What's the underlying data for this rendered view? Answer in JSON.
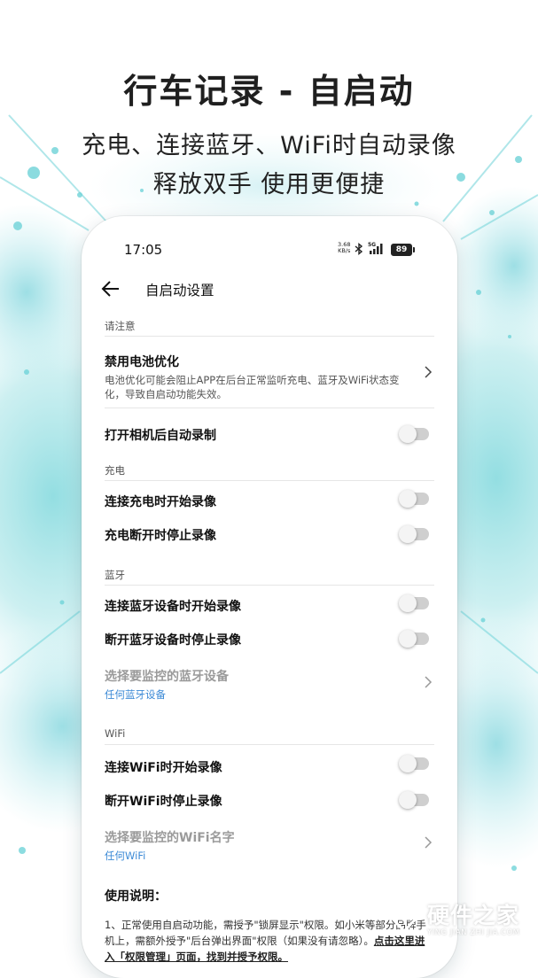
{
  "header": {
    "title": "行车记录 - 自启动",
    "subtitle_line1": "充电、连接蓝牙、WiFi时自动录像",
    "subtitle_line2": "释放双手  使用更便捷"
  },
  "status_bar": {
    "time": "17:05",
    "net_speed_value": "3.68",
    "net_speed_unit": "KB/s",
    "network": "5G",
    "battery": "89"
  },
  "page": {
    "title": "自启动设置"
  },
  "sections": {
    "notice": "请注意",
    "charging": "充电",
    "bluetooth": "蓝牙",
    "wifi": "WiFi"
  },
  "settings": {
    "battery_opt": {
      "title": "禁用电池优化",
      "desc": "电池优化可能会阻止APP在后台正常监听充电、蓝牙及WiFi状态变化，导致自启动功能失效。"
    },
    "camera_auto_record": {
      "title": "打开相机后自动录制",
      "enabled": false
    },
    "charge_start": {
      "title": "连接充电时开始录像",
      "enabled": false
    },
    "charge_stop": {
      "title": "充电断开时停止录像",
      "enabled": false
    },
    "bt_start": {
      "title": "连接蓝牙设备时开始录像",
      "enabled": false
    },
    "bt_stop": {
      "title": "断开蓝牙设备时停止录像",
      "enabled": false
    },
    "bt_select": {
      "title": "选择要监控的蓝牙设备",
      "value": "任何蓝牙设备"
    },
    "wifi_start": {
      "title": "连接WiFi时开始录像",
      "enabled": false
    },
    "wifi_stop": {
      "title": "断开WiFi时停止录像",
      "enabled": false
    },
    "wifi_select": {
      "title": "选择要监控的WiFi名字",
      "value": "任何WiFi"
    }
  },
  "usage": {
    "heading": "使用说明：",
    "text": "1、正常使用自启动功能，需授予\"锁屏显示\"权限。如小米等部分品牌手机上，需额外授予\"后台弹出界面\"权限（如果没有请忽略）。",
    "link": "点击这里进入「权限管理」页面，找到并授予权限。"
  },
  "watermark": {
    "name": "硬件之家",
    "pinyin": "YING JIAN ZHI JIA.COM"
  },
  "colors": {
    "accent_link": "#3c8ad6",
    "splash": "#6fd3d8",
    "toggle_off": "#cfcfcf"
  }
}
